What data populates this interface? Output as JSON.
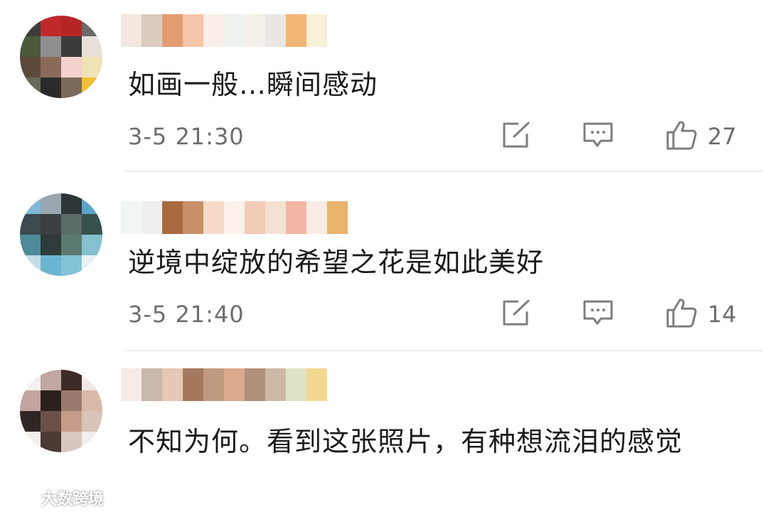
{
  "comments": [
    {
      "content": "如画一般…瞬间感动",
      "time": "3-5 21:30",
      "likes": "27",
      "avatar_colors": [
        "#3c3c3c",
        "#c0282a",
        "#b52525",
        "#6a6a6a",
        "#4a5a3a",
        "#8f8f8f",
        "#3a3a3a",
        "#e7e1d7",
        "#5b4a3c",
        "#8b6a5a",
        "#f5d1d0",
        "#efe2b4",
        "#6a6a58",
        "#2a2a2a",
        "#7a6a5a",
        "#f0c030"
      ],
      "username_colors": [
        "#f3e7df",
        "#d9cbbf",
        "#e29c72",
        "#f5c5a9",
        "#f9efe8",
        "#eef2ee",
        "#f5f1ea",
        "#e9e6e4",
        "#f1b675",
        "#f8f0d7"
      ]
    },
    {
      "content": "逆境中绽放的希望之花是如此美好",
      "time": "3-5 21:40",
      "likes": "14",
      "avatar_colors": [
        "#7fb8d6",
        "#9aa7b0",
        "#2d3536",
        "#5aa4c8",
        "#3b4a4c",
        "#3a4042",
        "#5b6b68",
        "#36514c",
        "#4d8a9a",
        "#2f3a3a",
        "#5a7a70",
        "#85c0cf",
        "#c4dde6",
        "#6ab5d0",
        "#82c3d6",
        "#e8f2f6"
      ],
      "username_colors": [
        "#f0f6f6",
        "#eef0f0",
        "#a86a3e",
        "#c99068",
        "#f8d9c9",
        "#fbf1ea",
        "#f2cbb6",
        "#f4e1d3",
        "#f1b6a4",
        "#f7ebe4",
        "#e7b46a"
      ]
    },
    {
      "content": "不知为何。看到这张照片，有种想流泪的感觉",
      "time": "",
      "likes": "",
      "avatar_colors": [
        "#f4eeee",
        "#c0a7a2",
        "#3c2b27",
        "#f0e8e6",
        "#c2a59f",
        "#2c201d",
        "#9b7b70",
        "#d8b9a8",
        "#2f2522",
        "#6b5048",
        "#c79d8a",
        "#d8c4b9",
        "#f3ece9",
        "#4c3a35",
        "#d7c7c0",
        "#f3eeeb"
      ],
      "username_colors": [
        "#f7ebe8",
        "#c9b7aa",
        "#e6c8b4",
        "#a57a5c",
        "#c09a80",
        "#dca98c",
        "#b1917c",
        "#cdb8a6",
        "#dfe2c5",
        "#f2d890"
      ]
    }
  ],
  "icons": {
    "repost": "repost-icon",
    "comment": "comment-icon",
    "like": "thumbs-up-icon"
  },
  "watermark": {
    "text": "大数跨境"
  },
  "colors": {
    "icon": "#7d7d7d",
    "text": "#1b1b1b",
    "meta": "#6d6d6d",
    "divider": "#ececec"
  }
}
